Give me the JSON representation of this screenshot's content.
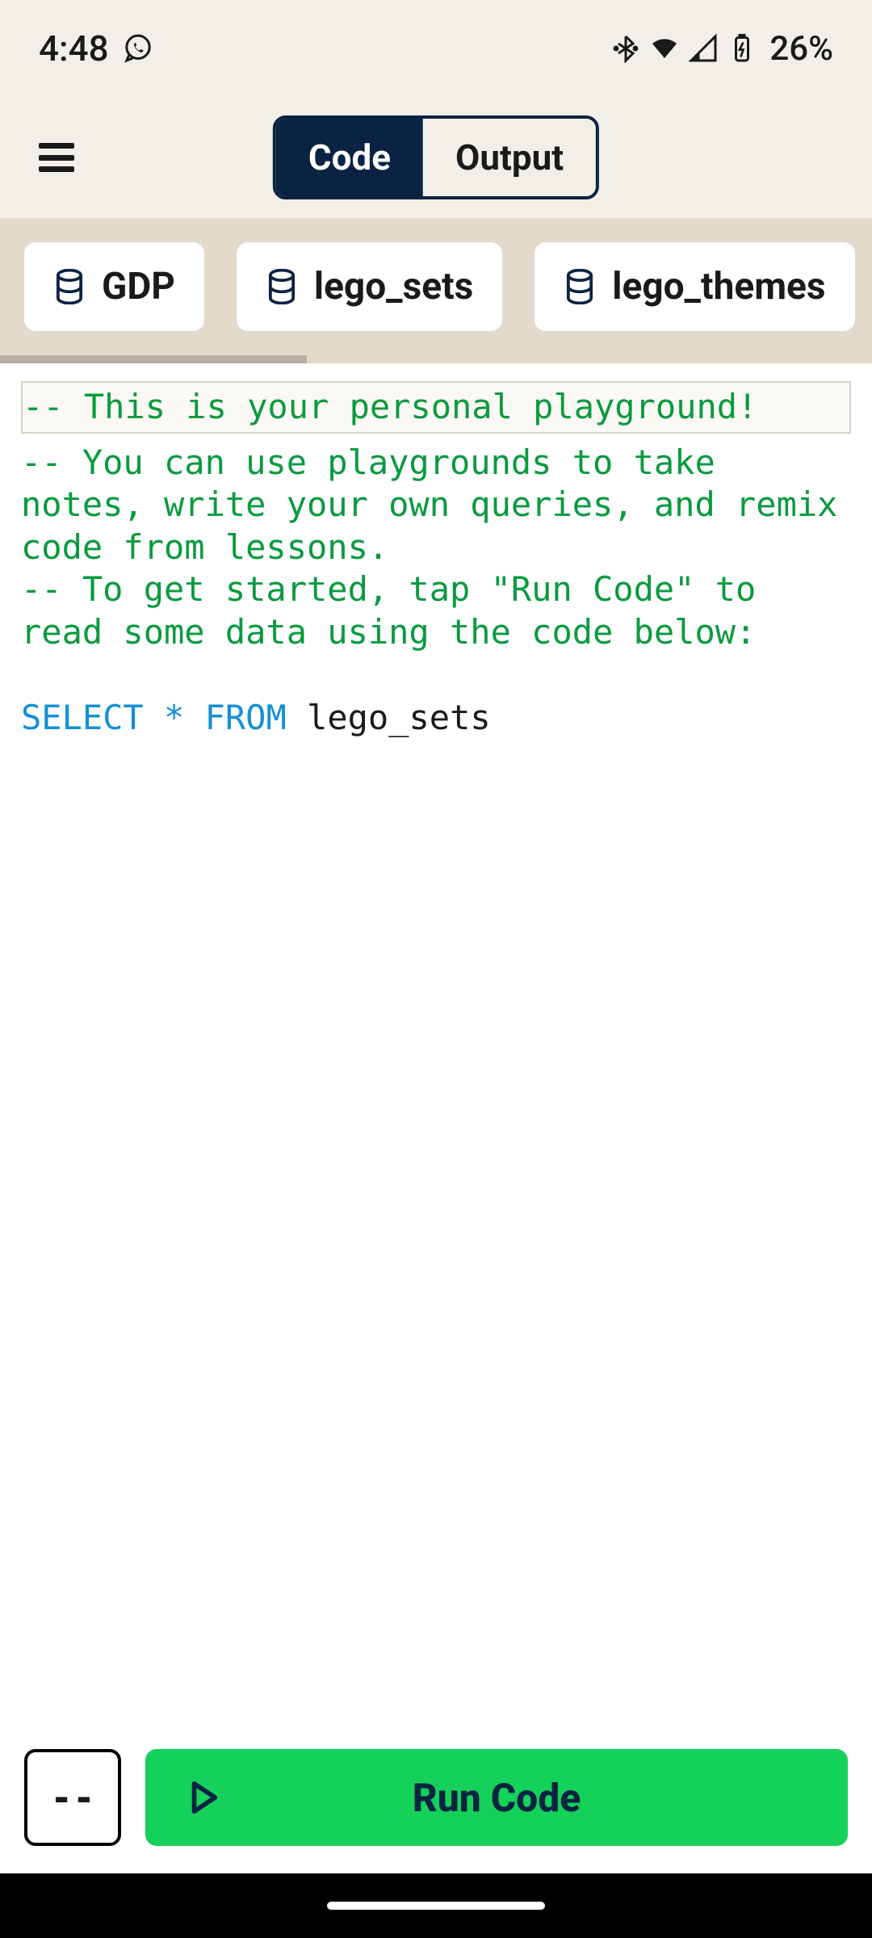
{
  "status": {
    "time": "4:48",
    "battery": "26%"
  },
  "header": {
    "segmented": {
      "code": "Code",
      "output": "Output"
    }
  },
  "tables": [
    {
      "label": "GDP"
    },
    {
      "label": "lego_sets"
    },
    {
      "label": "lego_themes"
    }
  ],
  "editor": {
    "comment_lines": [
      "-- This is your personal playground!",
      "-- You can use playgrounds to take notes, write your own queries, and remix code from lessons.",
      "-- To get started, tap \"Run Code\" to read some data using the code below:"
    ],
    "query": {
      "kw_select": "SELECT",
      "star": "*",
      "kw_from": "FROM",
      "table": "lego_sets"
    }
  },
  "bottom": {
    "comment_label": "--",
    "run_label": "Run Code"
  }
}
